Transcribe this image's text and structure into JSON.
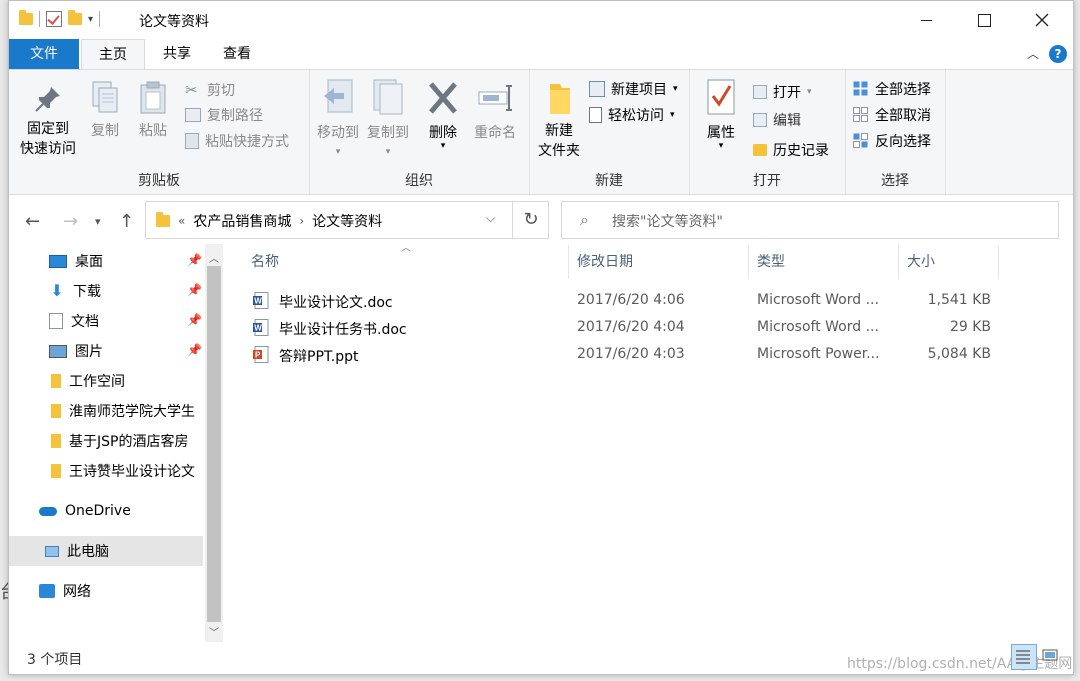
{
  "window": {
    "title": "论文等资料"
  },
  "ribbon_tabs": {
    "file": "文件",
    "home": "主页",
    "share": "共享",
    "view": "查看"
  },
  "clipboard": {
    "pin_line1": "固定到",
    "pin_line2": "快速访问",
    "copy": "复制",
    "paste": "粘贴",
    "cut": "剪切",
    "copy_path": "复制路径",
    "paste_shortcut": "粘贴快捷方式",
    "group": "剪贴板"
  },
  "organize": {
    "move_to": "移动到",
    "copy_to": "复制到",
    "delete": "删除",
    "rename": "重命名",
    "group": "组织"
  },
  "new": {
    "new_folder_line1": "新建",
    "new_folder_line2": "文件夹",
    "new_item": "新建项目",
    "easy_access": "轻松访问",
    "group": "新建"
  },
  "open": {
    "properties": "属性",
    "open": "打开",
    "edit": "编辑",
    "history": "历史记录",
    "group": "打开"
  },
  "select": {
    "select_all": "全部选择",
    "select_none": "全部取消",
    "invert": "反向选择",
    "group": "选择"
  },
  "address": {
    "overflow": "«",
    "crumbs": [
      "农产品销售商城",
      "论文等资料"
    ]
  },
  "search": {
    "placeholder": "搜索\"论文等资料\""
  },
  "nav": {
    "items": [
      "桌面",
      "下载",
      "文档",
      "图片",
      "工作空间",
      "淮南师范学院大学生",
      "基于JSP的酒店客房",
      "王诗赞毕业设计论文",
      "OneDrive",
      "此电脑",
      "网络"
    ]
  },
  "columns": {
    "name": "名称",
    "date": "修改日期",
    "type": "类型",
    "size": "大小"
  },
  "files": [
    {
      "name": "毕业设计论文.doc",
      "date": "2017/6/20 4:06",
      "type": "Microsoft Word ...",
      "size": "1,541 KB",
      "kind": "word"
    },
    {
      "name": "毕业设计任务书.doc",
      "date": "2017/6/20 4:04",
      "type": "Microsoft Word ...",
      "size": "29 KB",
      "kind": "word"
    },
    {
      "name": "答辩PPT.ppt",
      "date": "2017/6/20 4:03",
      "type": "Microsoft Power...",
      "size": "5,084 KB",
      "kind": "ppt"
    }
  ],
  "status": {
    "count": "3 个项目"
  },
  "watermark": "https://blog.csdn.net/AA@主题网X",
  "colors": {
    "accent": "#1979ca",
    "folder": "#f4c33b",
    "word": "#2b579a",
    "ppt": "#d24726"
  }
}
